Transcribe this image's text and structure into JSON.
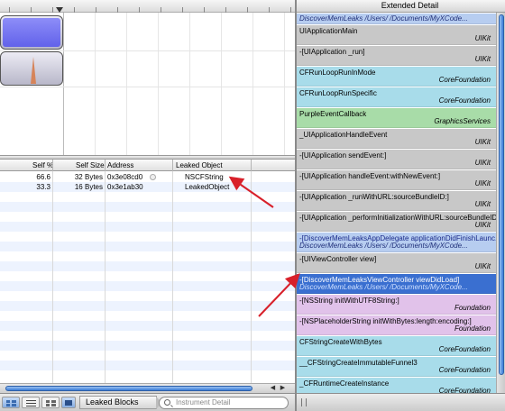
{
  "timeline": {
    "tracks": 2
  },
  "table": {
    "headers": [
      "Self %",
      "Self Size",
      "Address",
      "Leaked Object"
    ],
    "rows": [
      {
        "self_pct": "66.6",
        "self_size": "32 Bytes",
        "address": "0x3e08cd0",
        "object": "NSCFString"
      },
      {
        "self_pct": "33.3",
        "self_size": "16 Bytes",
        "address": "0x3e1ab30",
        "object": "LeakedObject"
      }
    ]
  },
  "bottom_bar": {
    "breadcrumb": "Leaked Blocks",
    "search_placeholder": "Instrument Detail"
  },
  "detail": {
    "title": "Extended Detail",
    "frames": [
      {
        "fn": "DiscoverMemLeaks /Users/         /Documents/MyXCode...",
        "lib": "",
        "style": "blue-italic"
      },
      {
        "fn": "UIApplicationMain",
        "lib": "UIKit",
        "style": "gray"
      },
      {
        "fn": "-[UIApplication _run]",
        "lib": "UIKit",
        "style": "gray"
      },
      {
        "fn": "CFRunLoopRunInMode",
        "lib": "CoreFoundation",
        "style": "cyan"
      },
      {
        "fn": "CFRunLoopRunSpecific",
        "lib": "CoreFoundation",
        "style": "cyan"
      },
      {
        "fn": "PurpleEventCallback",
        "lib": "GraphicsServices",
        "style": "green"
      },
      {
        "fn": "_UIApplicationHandleEvent",
        "lib": "UIKit",
        "style": "gray"
      },
      {
        "fn": "-[UIApplication sendEvent:]",
        "lib": "UIKit",
        "style": "gray"
      },
      {
        "fn": "-[UIApplication handleEvent:withNewEvent:]",
        "lib": "UIKit",
        "style": "gray"
      },
      {
        "fn": "-[UIApplication _runWithURL:sourceBundleID:]",
        "lib": "UIKit",
        "style": "gray"
      },
      {
        "fn": "-[UIApplication _performInitializationWithURL:sourceBundleID:]",
        "lib": "UIKit",
        "style": "gray"
      },
      {
        "fn": "-[DiscoverMemLeaksAppDelegate applicationDidFinishLaunc...",
        "lib": "DiscoverMemLeaks /Users/         /Documents/MyXCode...",
        "style": "blue-split"
      },
      {
        "fn": "-[UIViewController view]",
        "lib": "UIKit",
        "style": "gray"
      },
      {
        "fn": "-[DiscoverMemLeaksViewController viewDidLoad]",
        "lib": "DiscoverMemLeaks /Users/         /Documents/MyXCode...",
        "style": "selected"
      },
      {
        "fn": "-[NSString initWithUTF8String:]",
        "lib": "Foundation",
        "style": "purple"
      },
      {
        "fn": "-[NSPlaceholderString initWithBytes:length:encoding:]",
        "lib": "Foundation",
        "style": "purple"
      },
      {
        "fn": "CFStringCreateWithBytes",
        "lib": "CoreFoundation",
        "style": "cyan"
      },
      {
        "fn": "__CFStringCreateImmutableFunnel3",
        "lib": "CoreFoundation",
        "style": "cyan"
      },
      {
        "fn": "_CFRuntimeCreateInstance",
        "lib": "CoreFoundation",
        "style": "cyan"
      }
    ]
  },
  "colors": {
    "gray": "#c8c8c8",
    "cyan": "#a8dcea",
    "green": "#a8dca8",
    "purple": "#e1c2ea",
    "blue": "#b7cdf0",
    "selected": "#3a6fd0",
    "arrow": "#d8202a"
  }
}
